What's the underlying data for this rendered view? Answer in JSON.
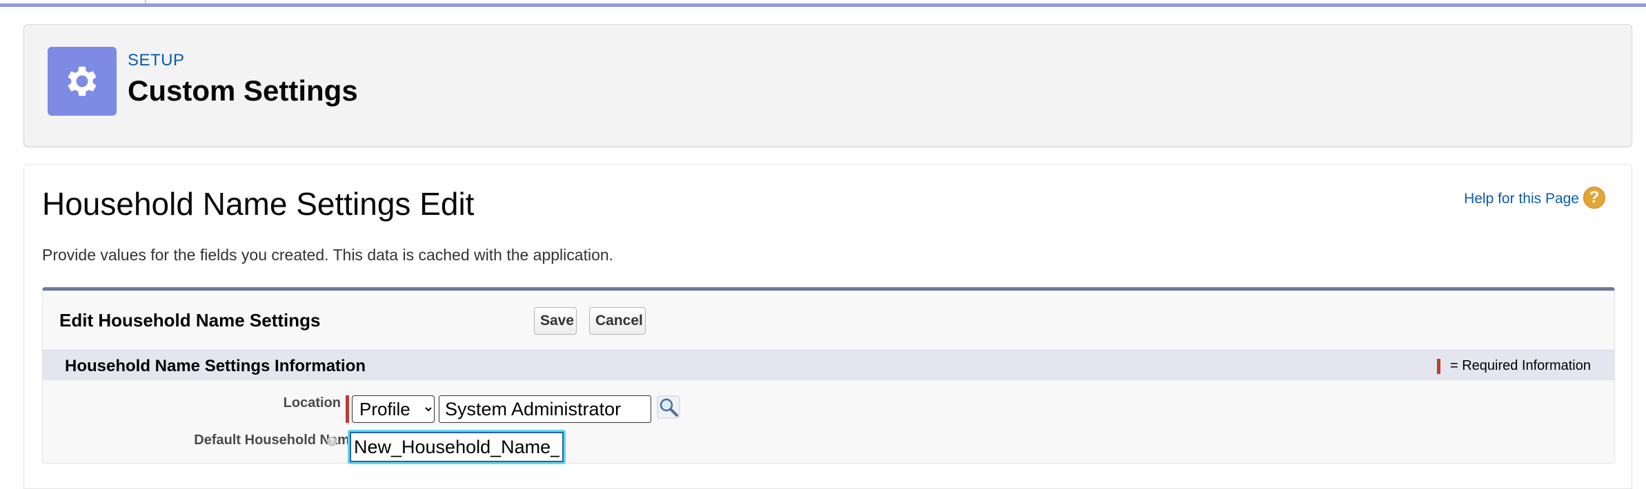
{
  "header": {
    "eyebrow": "SETUP",
    "title": "Custom Settings",
    "icon": "gear-icon",
    "accent_color": "#7e8be4"
  },
  "page": {
    "title": "Household Name Settings Edit",
    "help_link": "Help for this Page",
    "description": "Provide values for the fields you created. This data is cached with the application."
  },
  "edit": {
    "title": "Edit Household Name Settings",
    "save_label": "Save",
    "cancel_label": "Cancel"
  },
  "section": {
    "title": "Household Name Settings Information",
    "required_legend": "= Required Information",
    "required_color": "#c23934"
  },
  "fields": {
    "location_label": "Location",
    "location_type": "Profile",
    "location_value": "System Administrator",
    "default_name_label": "Default Household Name",
    "default_name_value": "New_Household_Name_"
  }
}
